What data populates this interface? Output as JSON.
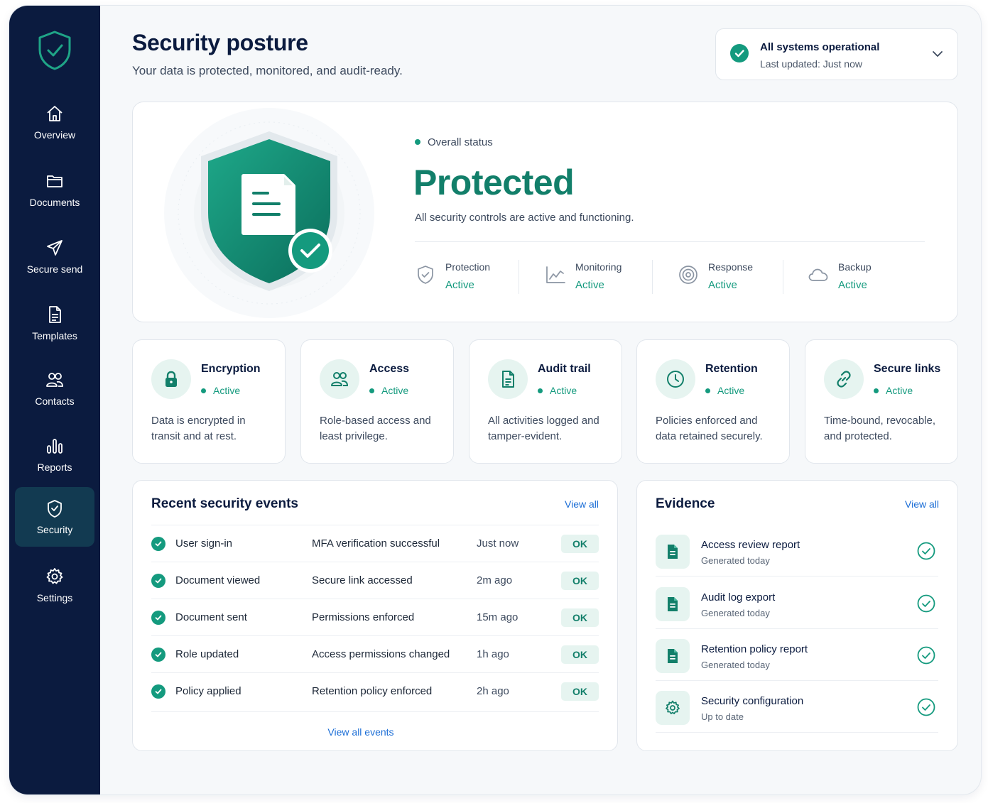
{
  "sidebar": {
    "items": [
      {
        "label": "Overview",
        "icon": "home-icon"
      },
      {
        "label": "Documents",
        "icon": "folder-icon"
      },
      {
        "label": "Secure send",
        "icon": "send-icon"
      },
      {
        "label": "Templates",
        "icon": "document-icon"
      },
      {
        "label": "Contacts",
        "icon": "users-icon"
      },
      {
        "label": "Reports",
        "icon": "bar-chart-icon"
      },
      {
        "label": "Security",
        "icon": "shield-icon",
        "active": true
      },
      {
        "label": "Settings",
        "icon": "gear-icon"
      }
    ]
  },
  "header": {
    "title": "Security posture",
    "subtitle": "Your data is protected, monitored, and audit-ready."
  },
  "system_status": {
    "title": "All systems operational",
    "updated": "Last updated: Just now"
  },
  "overview": {
    "label": "Overall status",
    "status": "Protected",
    "description": "All security controls are active and functioning.",
    "items": [
      {
        "label": "Protection",
        "value": "Active",
        "icon": "shield-check-icon"
      },
      {
        "label": "Monitoring",
        "value": "Active",
        "icon": "line-chart-icon"
      },
      {
        "label": "Response",
        "value": "Active",
        "icon": "target-icon"
      },
      {
        "label": "Backup",
        "value": "Active",
        "icon": "cloud-icon"
      }
    ]
  },
  "features": [
    {
      "name": "Encryption",
      "status": "Active",
      "desc": "Data is encrypted in transit and at rest.",
      "icon": "lock-icon"
    },
    {
      "name": "Access",
      "status": "Active",
      "desc": "Role-based access and least privilege.",
      "icon": "users-icon"
    },
    {
      "name": "Audit trail",
      "status": "Active",
      "desc": "All activities logged and tamper-evident.",
      "icon": "document-icon"
    },
    {
      "name": "Retention",
      "status": "Active",
      "desc": "Policies enforced and data retained securely.",
      "icon": "clock-icon"
    },
    {
      "name": "Secure links",
      "status": "Active",
      "desc": "Time-bound, revocable, and protected.",
      "icon": "link-icon"
    }
  ],
  "events": {
    "title": "Recent security events",
    "view_all": "View all",
    "footer_link": "View all events",
    "rows": [
      {
        "event": "User sign-in",
        "detail": "MFA verification successful",
        "time": "Just now",
        "status": "OK"
      },
      {
        "event": "Document viewed",
        "detail": "Secure link accessed",
        "time": "2m ago",
        "status": "OK"
      },
      {
        "event": "Document sent",
        "detail": "Permissions enforced",
        "time": "15m ago",
        "status": "OK"
      },
      {
        "event": "Role updated",
        "detail": "Access permissions changed",
        "time": "1h ago",
        "status": "OK"
      },
      {
        "event": "Policy applied",
        "detail": "Retention policy enforced",
        "time": "2h ago",
        "status": "OK"
      }
    ]
  },
  "evidence": {
    "title": "Evidence",
    "view_all": "View all",
    "items": [
      {
        "title": "Access review report",
        "sub": "Generated today",
        "icon": "file-icon"
      },
      {
        "title": "Audit log export",
        "sub": "Generated today",
        "icon": "file-icon"
      },
      {
        "title": "Retention policy report",
        "sub": "Generated today",
        "icon": "file-icon"
      },
      {
        "title": "Security configuration",
        "sub": "Up to date",
        "icon": "gear-icon"
      }
    ]
  },
  "colors": {
    "sidebar_bg": "#0b1b3f",
    "sidebar_active": "#123a51",
    "accent_green": "#149a7e",
    "link_blue": "#1c6ed6"
  }
}
